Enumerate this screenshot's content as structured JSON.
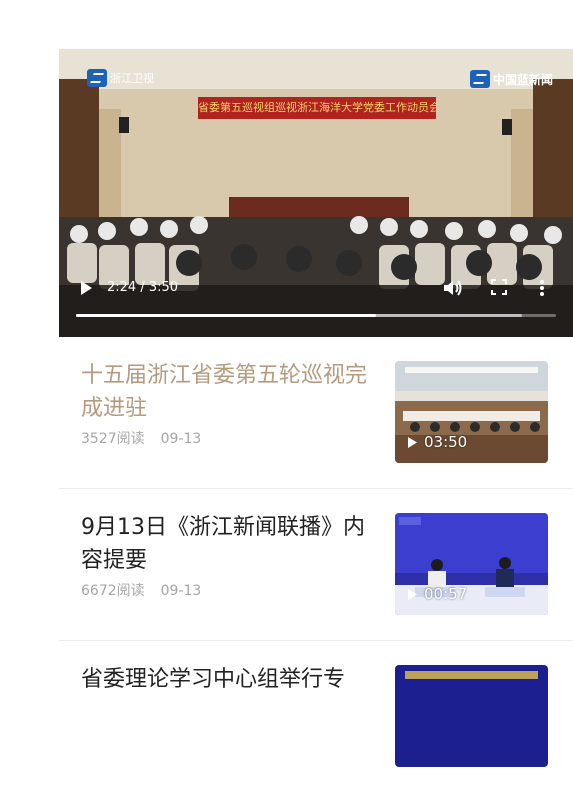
{
  "player": {
    "channel_logo": "浙江卫视",
    "watermark": "中国蓝新闻",
    "banner_text": "省委第五巡视组巡视浙江海洋大学党委工作动员会议",
    "current_time": "2:24",
    "duration": "3:50",
    "time_display": "2:24 / 3:50",
    "progress": 0.626,
    "buffered": 0.93,
    "icons": {
      "play": "play-icon",
      "volume": "volume-icon",
      "fullscreen": "fullscreen-icon",
      "more": "more-vertical-icon"
    }
  },
  "news": [
    {
      "title": "十五届浙江省委第五轮巡视完成进驻",
      "reads": "3527阅读",
      "date": "09-13",
      "duration": "03:50",
      "read": true
    },
    {
      "title": "9月13日《浙江新闻联播》内容提要",
      "reads": "6672阅读",
      "date": "09-13",
      "duration": "00:57",
      "read": false
    },
    {
      "title": "省委理论学习中心组举行专",
      "reads": "",
      "date": "",
      "duration": "",
      "read": false
    }
  ]
}
